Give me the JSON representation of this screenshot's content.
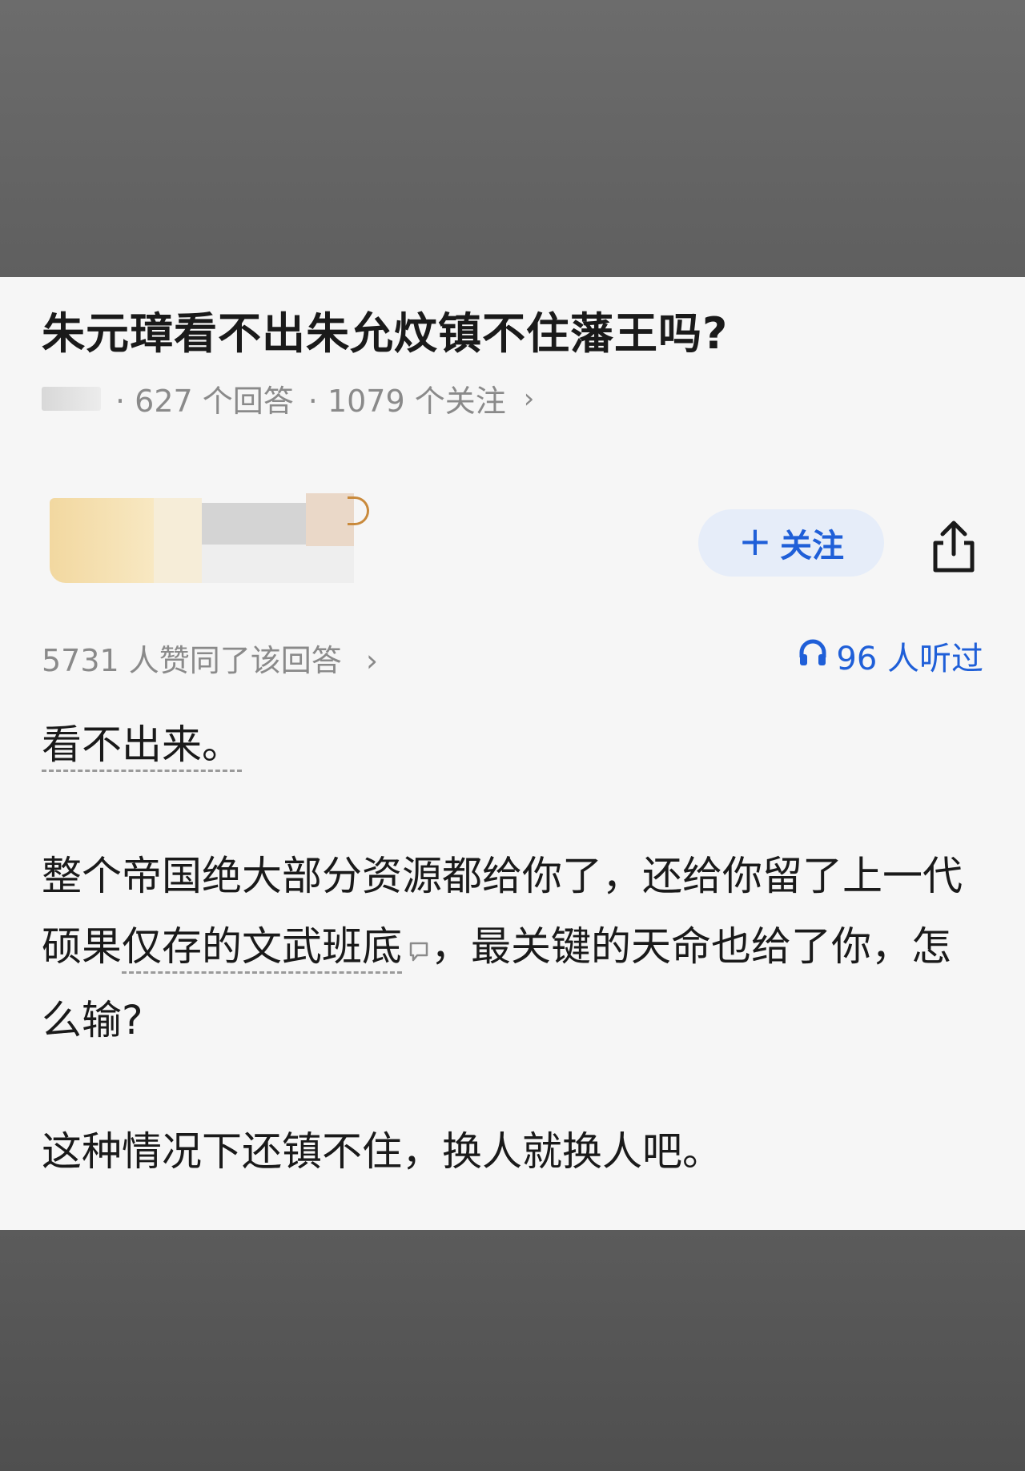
{
  "question": {
    "title": "朱元璋看不出朱允炆镇不住藩王吗?",
    "answers": "· 627 个回答",
    "followers": "· 1079 个关注"
  },
  "answer": {
    "follow_label": "关注",
    "likes": "5731 人赞同了该回答",
    "listens": "96 人听过",
    "paragraph1": "看不出来。",
    "paragraph2_part1": "整个帝国绝大部分资源都给你了，还给你留了上一代硕果",
    "paragraph2_linked": "仅存的文武班底",
    "paragraph2_part2": "，最关键的天命也给了你，怎么输?",
    "paragraph3": "这种情况下还镇不住，换人就换人吧。"
  },
  "colors": {
    "accent": "#1f5fd8",
    "follow_bg": "#e6edf9",
    "meta_text": "#8a8a8a"
  },
  "icons": [
    "plus-icon",
    "share-icon",
    "chevron-right-icon",
    "headphones-icon",
    "comment-icon"
  ]
}
